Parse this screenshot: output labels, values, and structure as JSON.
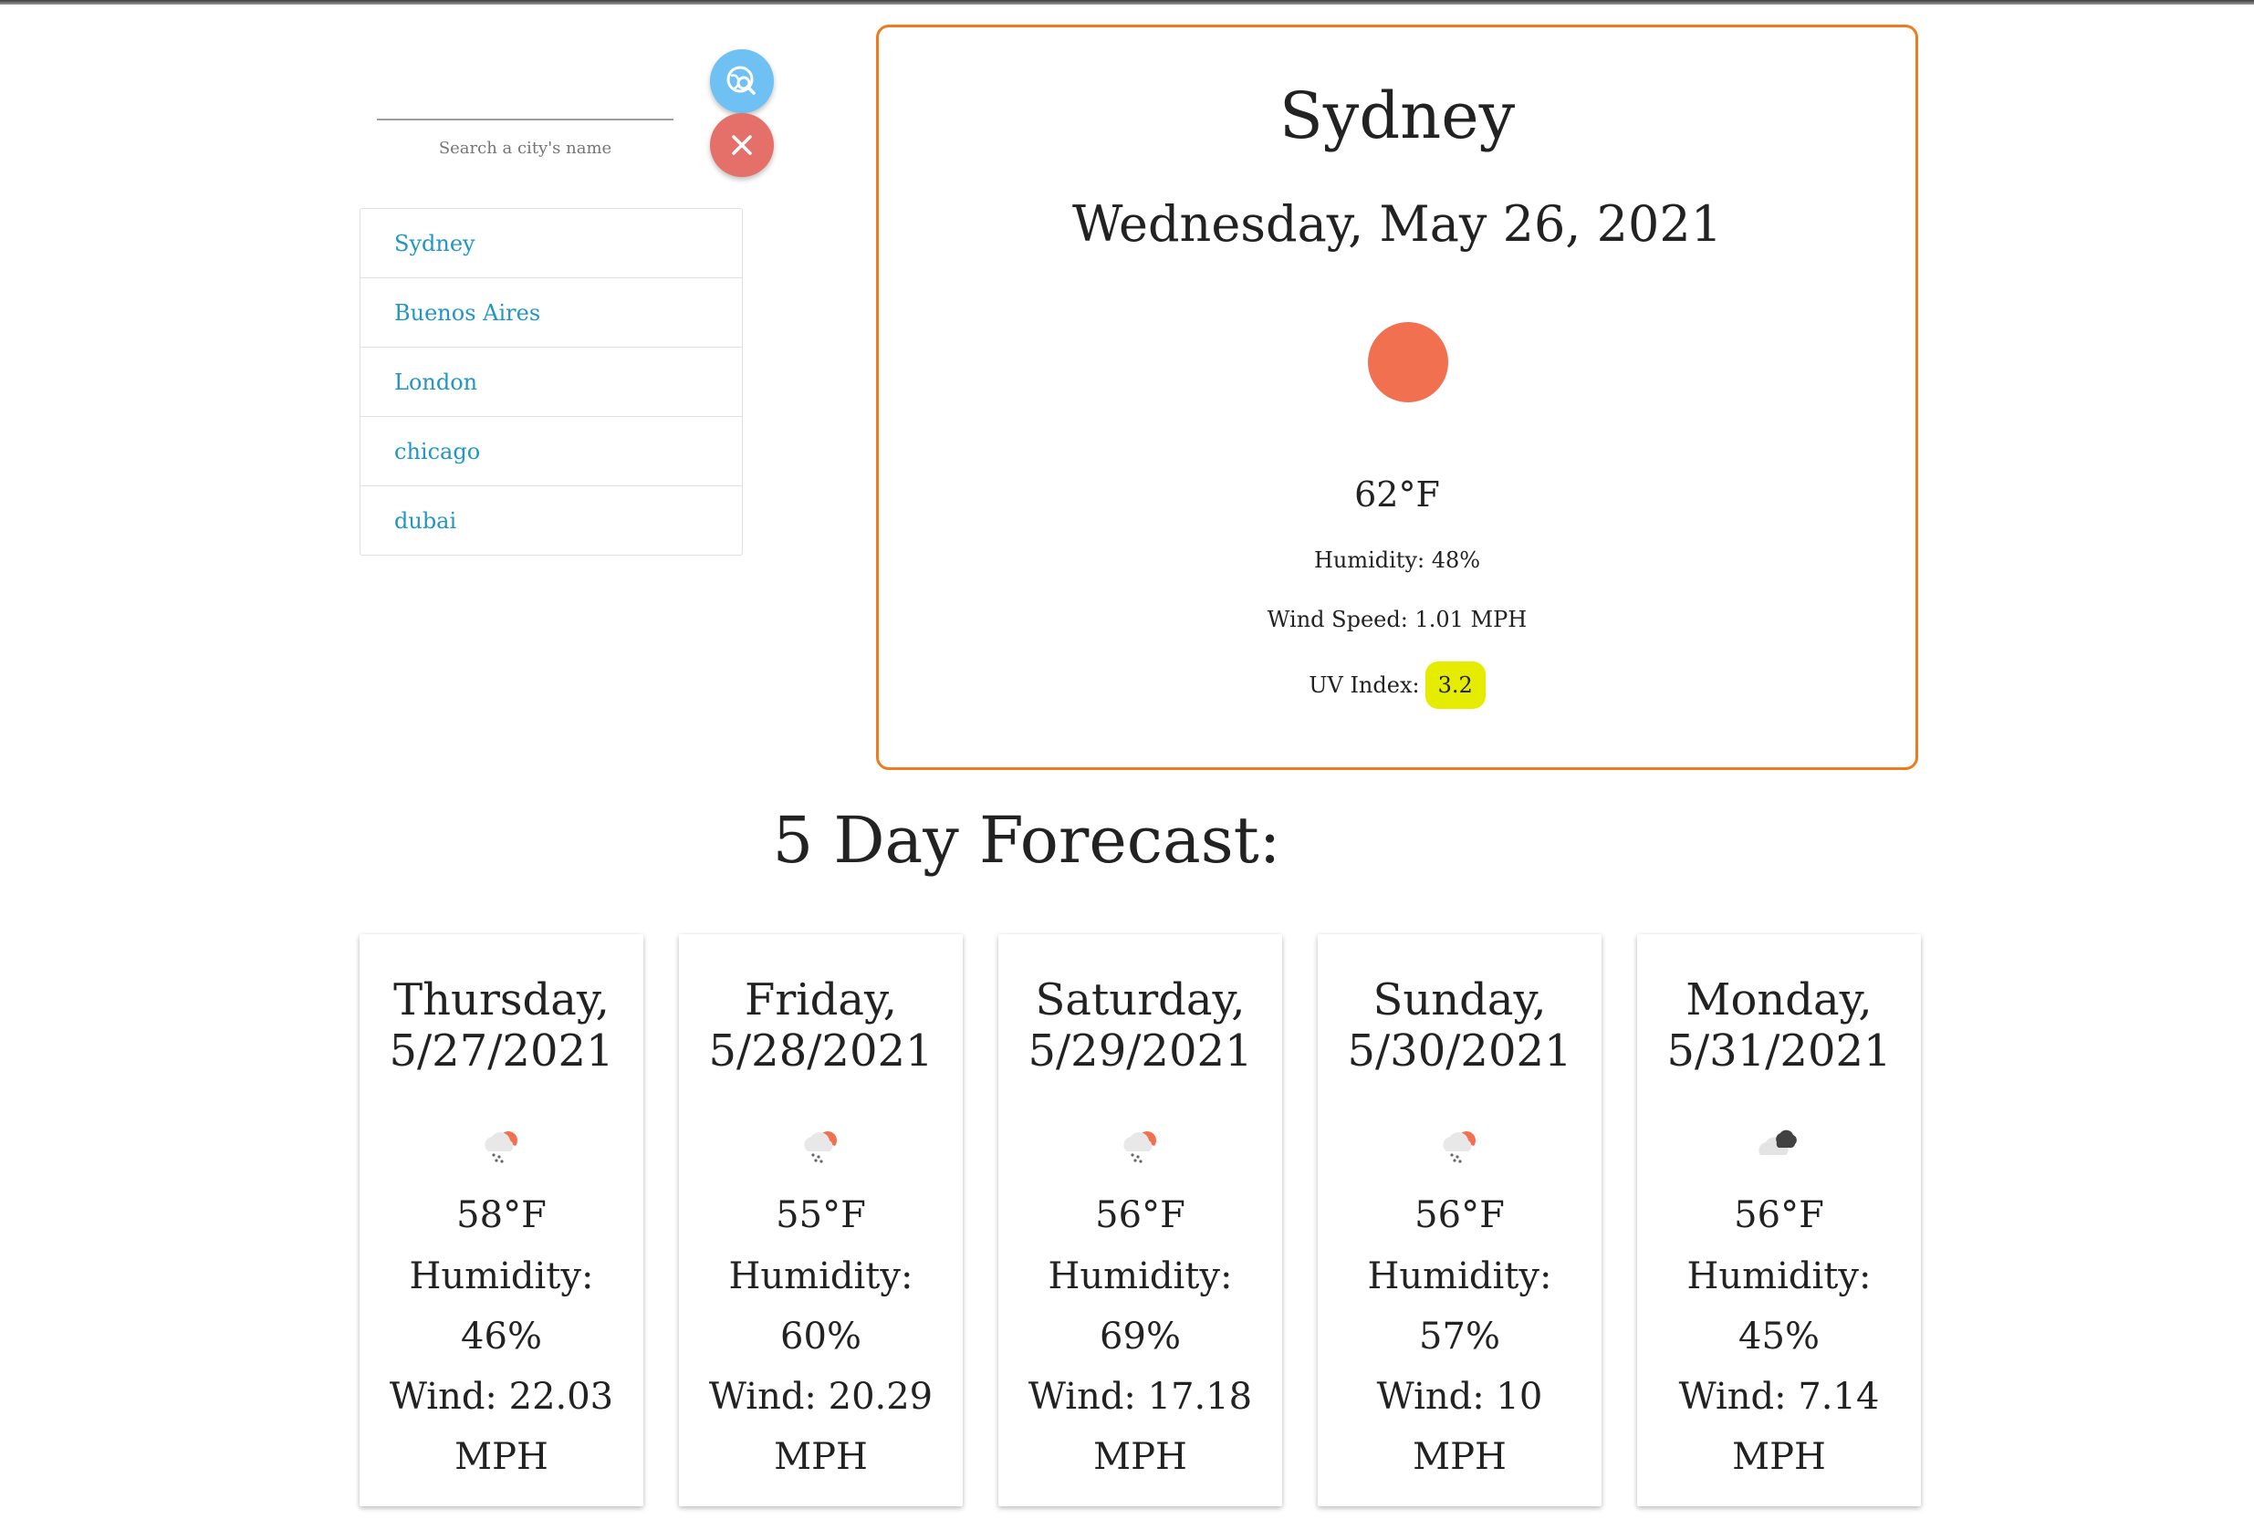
{
  "search": {
    "placeholder": "",
    "label": "Search a city's name",
    "search_icon": "globe-search-icon",
    "clear_icon": "close-icon"
  },
  "history": [
    {
      "name": "Sydney"
    },
    {
      "name": "Buenos Aires"
    },
    {
      "name": "London"
    },
    {
      "name": "chicago"
    },
    {
      "name": "dubai"
    }
  ],
  "current": {
    "city": "Sydney",
    "date": "Wednesday, May 26, 2021",
    "icon": "sun-icon",
    "temp": "62°F",
    "humidity": "Humidity: 48%",
    "wind": "Wind Speed: 1.01 MPH",
    "uv_label": "UV Index:",
    "uv_value": "3.2",
    "colors": {
      "border": "#f07b1d",
      "uv_badge": "#e5ec00",
      "sun": "#f07050"
    }
  },
  "forecast_title": "5 Day Forecast:",
  "forecast": [
    {
      "date_line1": "Thursday,",
      "date_line2": "5/27/2021",
      "icon": "rain-sun-icon",
      "temp": "58°F",
      "humidity_label": "Humidity:",
      "humidity_value": "46%",
      "wind_line1": "Wind: 22.03",
      "wind_line2": "MPH"
    },
    {
      "date_line1": "Friday,",
      "date_line2": "5/28/2021",
      "icon": "rain-sun-icon",
      "temp": "55°F",
      "humidity_label": "Humidity:",
      "humidity_value": "60%",
      "wind_line1": "Wind: 20.29",
      "wind_line2": "MPH"
    },
    {
      "date_line1": "Saturday,",
      "date_line2": "5/29/2021",
      "icon": "rain-sun-icon",
      "temp": "56°F",
      "humidity_label": "Humidity:",
      "humidity_value": "69%",
      "wind_line1": "Wind: 17.18",
      "wind_line2": "MPH"
    },
    {
      "date_line1": "Sunday,",
      "date_line2": "5/30/2021",
      "icon": "rain-sun-icon",
      "temp": "56°F",
      "humidity_label": "Humidity:",
      "humidity_value": "57%",
      "wind_line1": "Wind: 10",
      "wind_line2": "MPH"
    },
    {
      "date_line1": "Monday,",
      "date_line2": "5/31/2021",
      "icon": "cloudy-icon",
      "temp": "56°F",
      "humidity_label": "Humidity:",
      "humidity_value": "45%",
      "wind_line1": "Wind: 7.14",
      "wind_line2": "MPH"
    }
  ]
}
